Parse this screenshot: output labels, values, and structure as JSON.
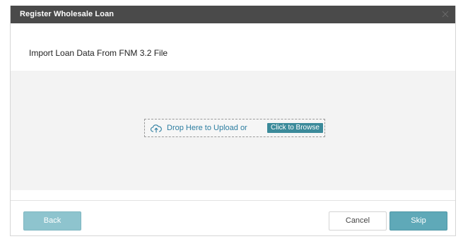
{
  "modal": {
    "title": "Register Wholesale Loan",
    "section_title": "Import Loan Data From FNM 3.2 File"
  },
  "upload": {
    "icon": "cloud-upload-icon",
    "drop_text": "Drop Here to Upload or",
    "browse_label": "Click to Browse"
  },
  "footer": {
    "back_label": "Back",
    "cancel_label": "Cancel",
    "skip_label": "Skip"
  },
  "colors": {
    "header_bg": "#4a4a4a",
    "accent": "#5fa9b8",
    "back_button": "#8ec4ce",
    "link_text": "#2c7da0",
    "drop_area_bg": "#f3f3f3"
  }
}
